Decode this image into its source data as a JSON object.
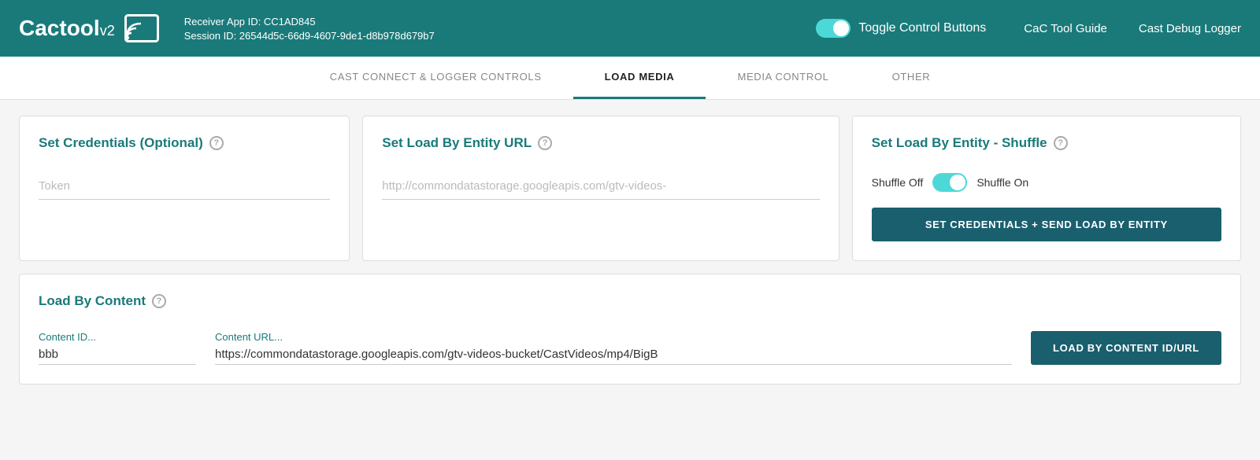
{
  "header": {
    "logo_text": "Cactool",
    "logo_version": "v2",
    "receiver_app_id_label": "Receiver App ID: CC1AD845",
    "session_id_label": "Session ID: 26544d5c-66d9-4607-9de1-d8b978d679b7",
    "toggle_label": "Toggle Control Buttons",
    "nav_links": [
      {
        "label": "CaC Tool Guide",
        "name": "cac-tool-guide-link"
      },
      {
        "label": "Cast Debug Logger",
        "name": "cast-debug-logger-link"
      }
    ]
  },
  "tabs": [
    {
      "label": "CAST CONNECT & LOGGER CONTROLS",
      "name": "tab-cast-connect",
      "active": false
    },
    {
      "label": "LOAD MEDIA",
      "name": "tab-load-media",
      "active": true
    },
    {
      "label": "MEDIA CONTROL",
      "name": "tab-media-control",
      "active": false
    },
    {
      "label": "OTHER",
      "name": "tab-other",
      "active": false
    }
  ],
  "main": {
    "credentials_card": {
      "title": "Set Credentials (Optional)",
      "token_placeholder": "Token"
    },
    "entity_url_card": {
      "title": "Set Load By Entity URL",
      "url_placeholder": "http://commondatastorage.googleapis.com/gtv-videos-"
    },
    "entity_shuffle_card": {
      "title": "Set Load By Entity - Shuffle",
      "shuffle_off_label": "Shuffle Off",
      "shuffle_on_label": "Shuffle On",
      "button_label": "SET CREDENTIALS + SEND LOAD BY ENTITY"
    },
    "load_content_card": {
      "title": "Load By Content",
      "content_id_label": "Content ID...",
      "content_id_value": "bbb",
      "content_url_label": "Content URL...",
      "content_url_value": "https://commondatastorage.googleapis.com/gtv-videos-bucket/CastVideos/mp4/BigB",
      "button_label": "LOAD BY CONTENT ID/URL"
    }
  },
  "icons": {
    "help": "?",
    "cast_waves": "≋"
  },
  "colors": {
    "teal_dark": "#1a7a7a",
    "teal_button": "#1a5f6e",
    "teal_light": "#4dd8d8"
  }
}
